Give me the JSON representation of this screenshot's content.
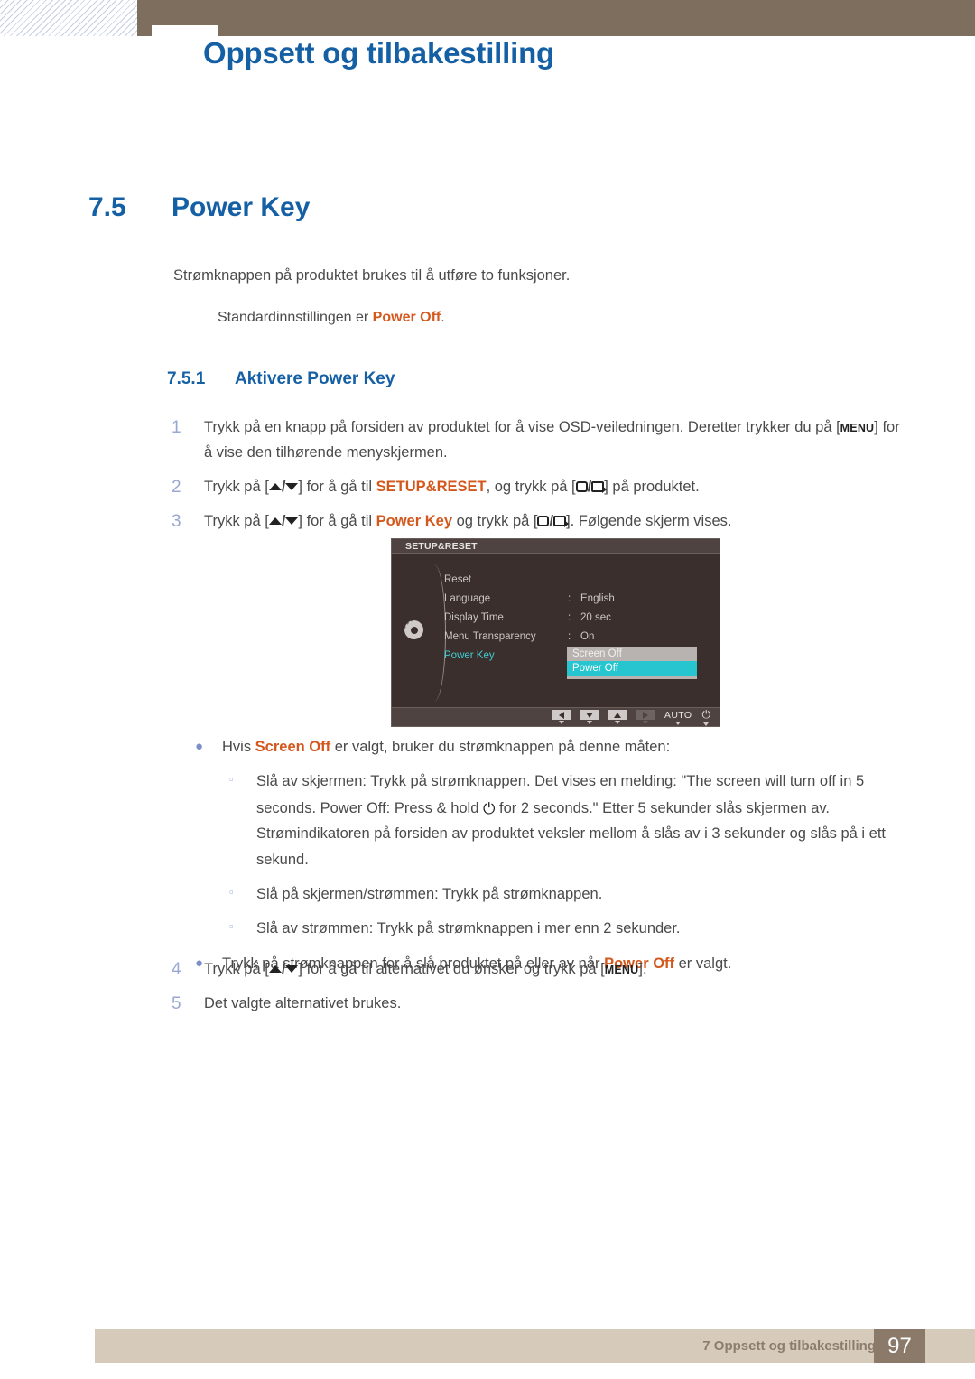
{
  "header": {
    "title": "Oppsett og tilbakestilling"
  },
  "section": {
    "number": "7.5",
    "title": "Power Key",
    "intro_1": "Strømknappen på produktet brukes til å utføre to funksjoner.",
    "intro_2_prefix": "Standardinnstillingen er ",
    "intro_2_highlight": "Power Off",
    "intro_2_suffix": "."
  },
  "subsection": {
    "number": "7.5.1",
    "title": "Aktivere Power Key"
  },
  "steps": [
    {
      "num": "1",
      "t1": "Trykk på en knapp på forsiden av produktet for å vise OSD-veiledningen. Deretter trykker du på [",
      "key": "MENU",
      "t2": "] for å vise den tilhørende menyskjermen."
    },
    {
      "num": "2",
      "t1": "Trykk på [",
      "t2": "] for å gå til ",
      "hl": "SETUP&RESET",
      "t3": ", og trykk på [",
      "t4": "] på produktet."
    },
    {
      "num": "3",
      "t1": "Trykk på [",
      "t2": "] for å gå til ",
      "hl": "Power Key",
      "t3": " og trykk på [",
      "t4": "]. Følgende skjerm vises."
    }
  ],
  "osd": {
    "title": "SETUP&RESET",
    "rows": [
      {
        "label": "Reset",
        "colon": "",
        "value": ""
      },
      {
        "label": "Language",
        "colon": ":",
        "value": "English"
      },
      {
        "label": "Display Time",
        "colon": ":",
        "value": "20 sec"
      },
      {
        "label": "Menu Transparency",
        "colon": ":",
        "value": "On"
      },
      {
        "label": "Power Key",
        "colon": ":",
        "value": ""
      }
    ],
    "options": [
      {
        "label": "Screen Off",
        "selected": false
      },
      {
        "label": "Power Off",
        "selected": true
      }
    ],
    "auto_label": "AUTO",
    "power_glyph": "⏻",
    "highlight_color": "#27c5cf",
    "active_label_color": "#3ecfd6"
  },
  "bullets": {
    "b1_pre": "Hvis ",
    "b1_hl": "Screen Off",
    "b1_post": " er valgt, bruker du strømknappen på denne måten:",
    "s1_a": "Slå av skjermen: Trykk på strømknappen. Det vises en melding: \"The screen will turn off in 5 seconds. Power Off: Press & hold ",
    "s1_b": " for 2 seconds.\" Etter 5 sekunder slås skjermen av. Strømindikatoren på forsiden av produktet veksler mellom å slås av i 3 sekunder og slås på i ett sekund.",
    "s2": "Slå på skjermen/strømmen: Trykk på strømknappen.",
    "s3": "Slå av strømmen: Trykk på strømknappen i mer enn 2 sekunder.",
    "b2_pre": "Trykk på strømknappen for å slå produktet på eller av når ",
    "b2_hl": "Power Off",
    "b2_post": " er valgt."
  },
  "steps2": [
    {
      "num": "4",
      "t1": "Trykk på [",
      "t2": "] for å gå til alternativet du ønsker og trykk på [",
      "key": "MENU",
      "t3": "]."
    },
    {
      "num": "5",
      "t1": "Det valgte alternativet brukes."
    }
  ],
  "footer": {
    "text": "7 Oppsett og tilbakestilling",
    "page": "97"
  }
}
